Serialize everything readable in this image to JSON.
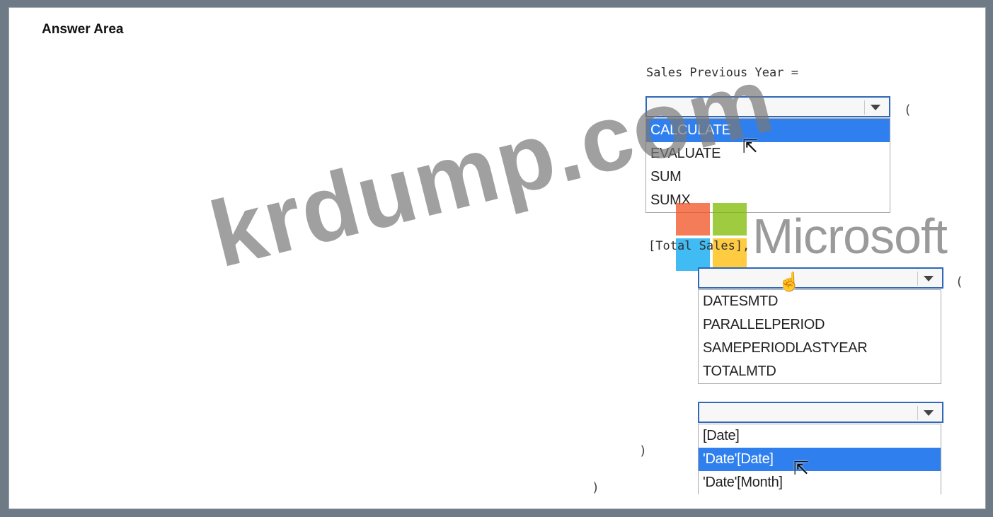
{
  "answer_area": {
    "title": "Answer Area"
  },
  "code": {
    "line1": "Sales Previous Year =",
    "open_paren": "(",
    "line2": "[Total Sales],",
    "close_paren_inner": ")",
    "close_paren_outer": ")"
  },
  "dropdown1": {
    "value": "",
    "options": [
      "CALCULATE",
      "EVALUATE",
      "SUM",
      "SUMX"
    ],
    "hovered": "CALCULATE"
  },
  "dropdown2": {
    "value": "",
    "options": [
      "DATESMTD",
      "PARALLELPERIOD",
      "SAMEPERIODLASTYEAR",
      "TOTALMTD"
    ]
  },
  "dropdown3": {
    "value": "",
    "options": [
      "[Date]",
      "'Date'[Date]",
      "'Date'[Month]"
    ],
    "hovered": "'Date'[Date]"
  },
  "watermark": {
    "text": "krdump.com",
    "brand": "Microsoft"
  },
  "colors": {
    "accent": "#2f80ee",
    "ms_red": "#f25022",
    "ms_green": "#7fba00",
    "ms_blue": "#00a4ef",
    "ms_yellow": "#ffb900"
  }
}
